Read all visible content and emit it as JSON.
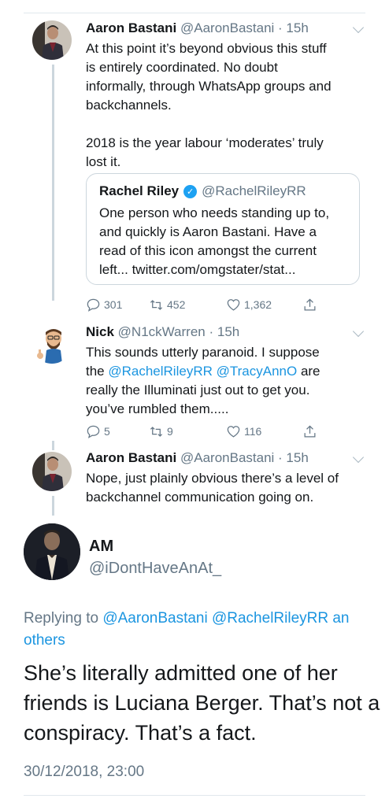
{
  "tweets": [
    {
      "name": "Aaron Bastani",
      "handle": "@AaronBastani",
      "time": "15h",
      "text_lines": [
        "At this point it’s beyond obvious this stuff",
        "is entirely coordinated. No doubt",
        "informally, through WhatsApp groups and",
        "backchannels.",
        "",
        "2018 is the year labour ‘moderates’ truly",
        "lost it."
      ],
      "quote": {
        "name": "Rachel Riley",
        "handle": "@RachelRileyRR",
        "text_lines": [
          "One person who needs standing up to,",
          "and quickly is Aaron Bastani. Have a",
          "read of this icon amongst the current",
          "left... twitter.com/omgstater/stat..."
        ]
      },
      "replies": "301",
      "retweets": "452",
      "likes": "1,362"
    },
    {
      "name": "Nick",
      "handle": "@N1ckWarren",
      "time": "15h",
      "line1": "This sounds utterly paranoid. I suppose",
      "line2_pre": "the ",
      "mention1": "@RachelRileyRR",
      "mention2": "@TracyAnnO",
      "line2_post": " are",
      "line3": "really the Illuminati just out to get you.",
      "line4": "you’ve rumbled them.....",
      "replies": "5",
      "retweets": "9",
      "likes": "116"
    },
    {
      "name": "Aaron Bastani",
      "handle": "@AaronBastani",
      "time": "15h",
      "text_lines": [
        "Nope, just plainly obvious there’s a level of",
        "backchannel communication going on."
      ]
    }
  ],
  "main": {
    "name": "AM",
    "handle": "@iDontHaveAnAt_",
    "replying_prefix": "Replying to ",
    "replying_mentions": "@AaronBastani @RachelRileyRR an",
    "replying_line2": "others",
    "text_lines": [
      "She’s literally admitted one of her",
      "friends is Luciana Berger. That’s not a",
      "conspiracy. That’s a fact."
    ],
    "timestamp": "30/12/2018, 23:00"
  },
  "icons": {
    "reply": "reply-icon",
    "retweet": "retweet-icon",
    "like": "heart-icon",
    "share": "share-icon",
    "verified": "verified-badge-icon",
    "more": "chevron-down-icon"
  },
  "colors": {
    "link": "#1b95e0",
    "secondary": "#657786",
    "verified": "#1da1f2"
  }
}
